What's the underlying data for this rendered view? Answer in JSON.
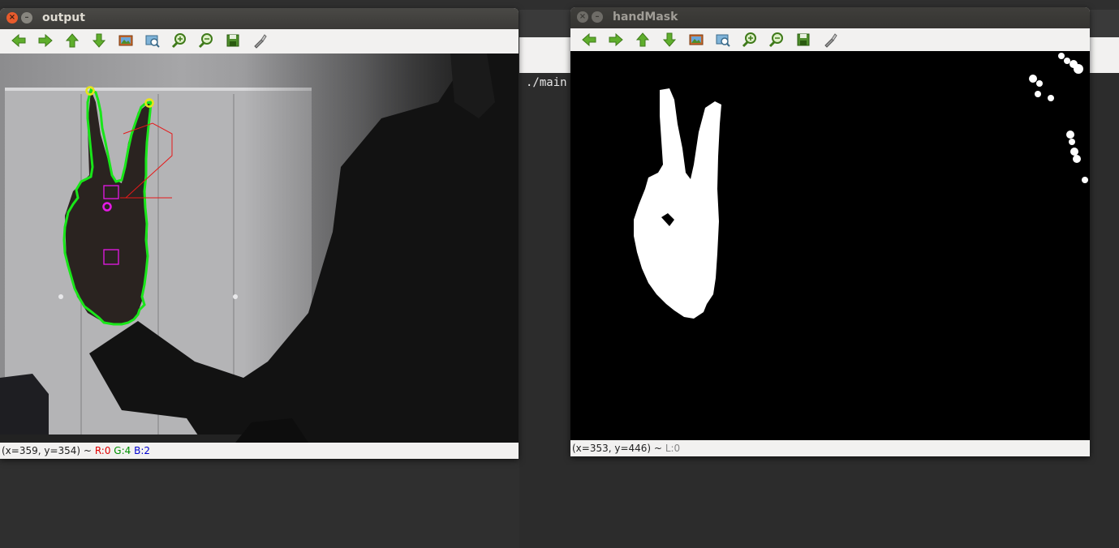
{
  "terminal": {
    "command_text": "./main"
  },
  "windows": {
    "output": {
      "title": "output",
      "status": {
        "coords": "(x=359, y=354) ~",
        "r": "R:0",
        "g": "G:4",
        "b": "B:2",
        "r_color": "#e00000",
        "g_color": "#009000",
        "b_color": "#0000d0"
      }
    },
    "handmask": {
      "title": "handMask",
      "status": {
        "coords": "(x=353, y=446) ~",
        "l": "L:0",
        "l_color": "#888888"
      }
    }
  },
  "toolbar_icons": [
    "arrow-left-icon",
    "arrow-right-icon",
    "arrow-up-icon",
    "arrow-down-icon",
    "image-icon",
    "zoom-fit-icon",
    "zoom-in-icon",
    "zoom-out-icon",
    "save-icon",
    "properties-icon"
  ],
  "colors": {
    "contour": "#19e619",
    "fingertip": "#e6e619",
    "center": "#e619e6",
    "hull": "#e61919"
  }
}
